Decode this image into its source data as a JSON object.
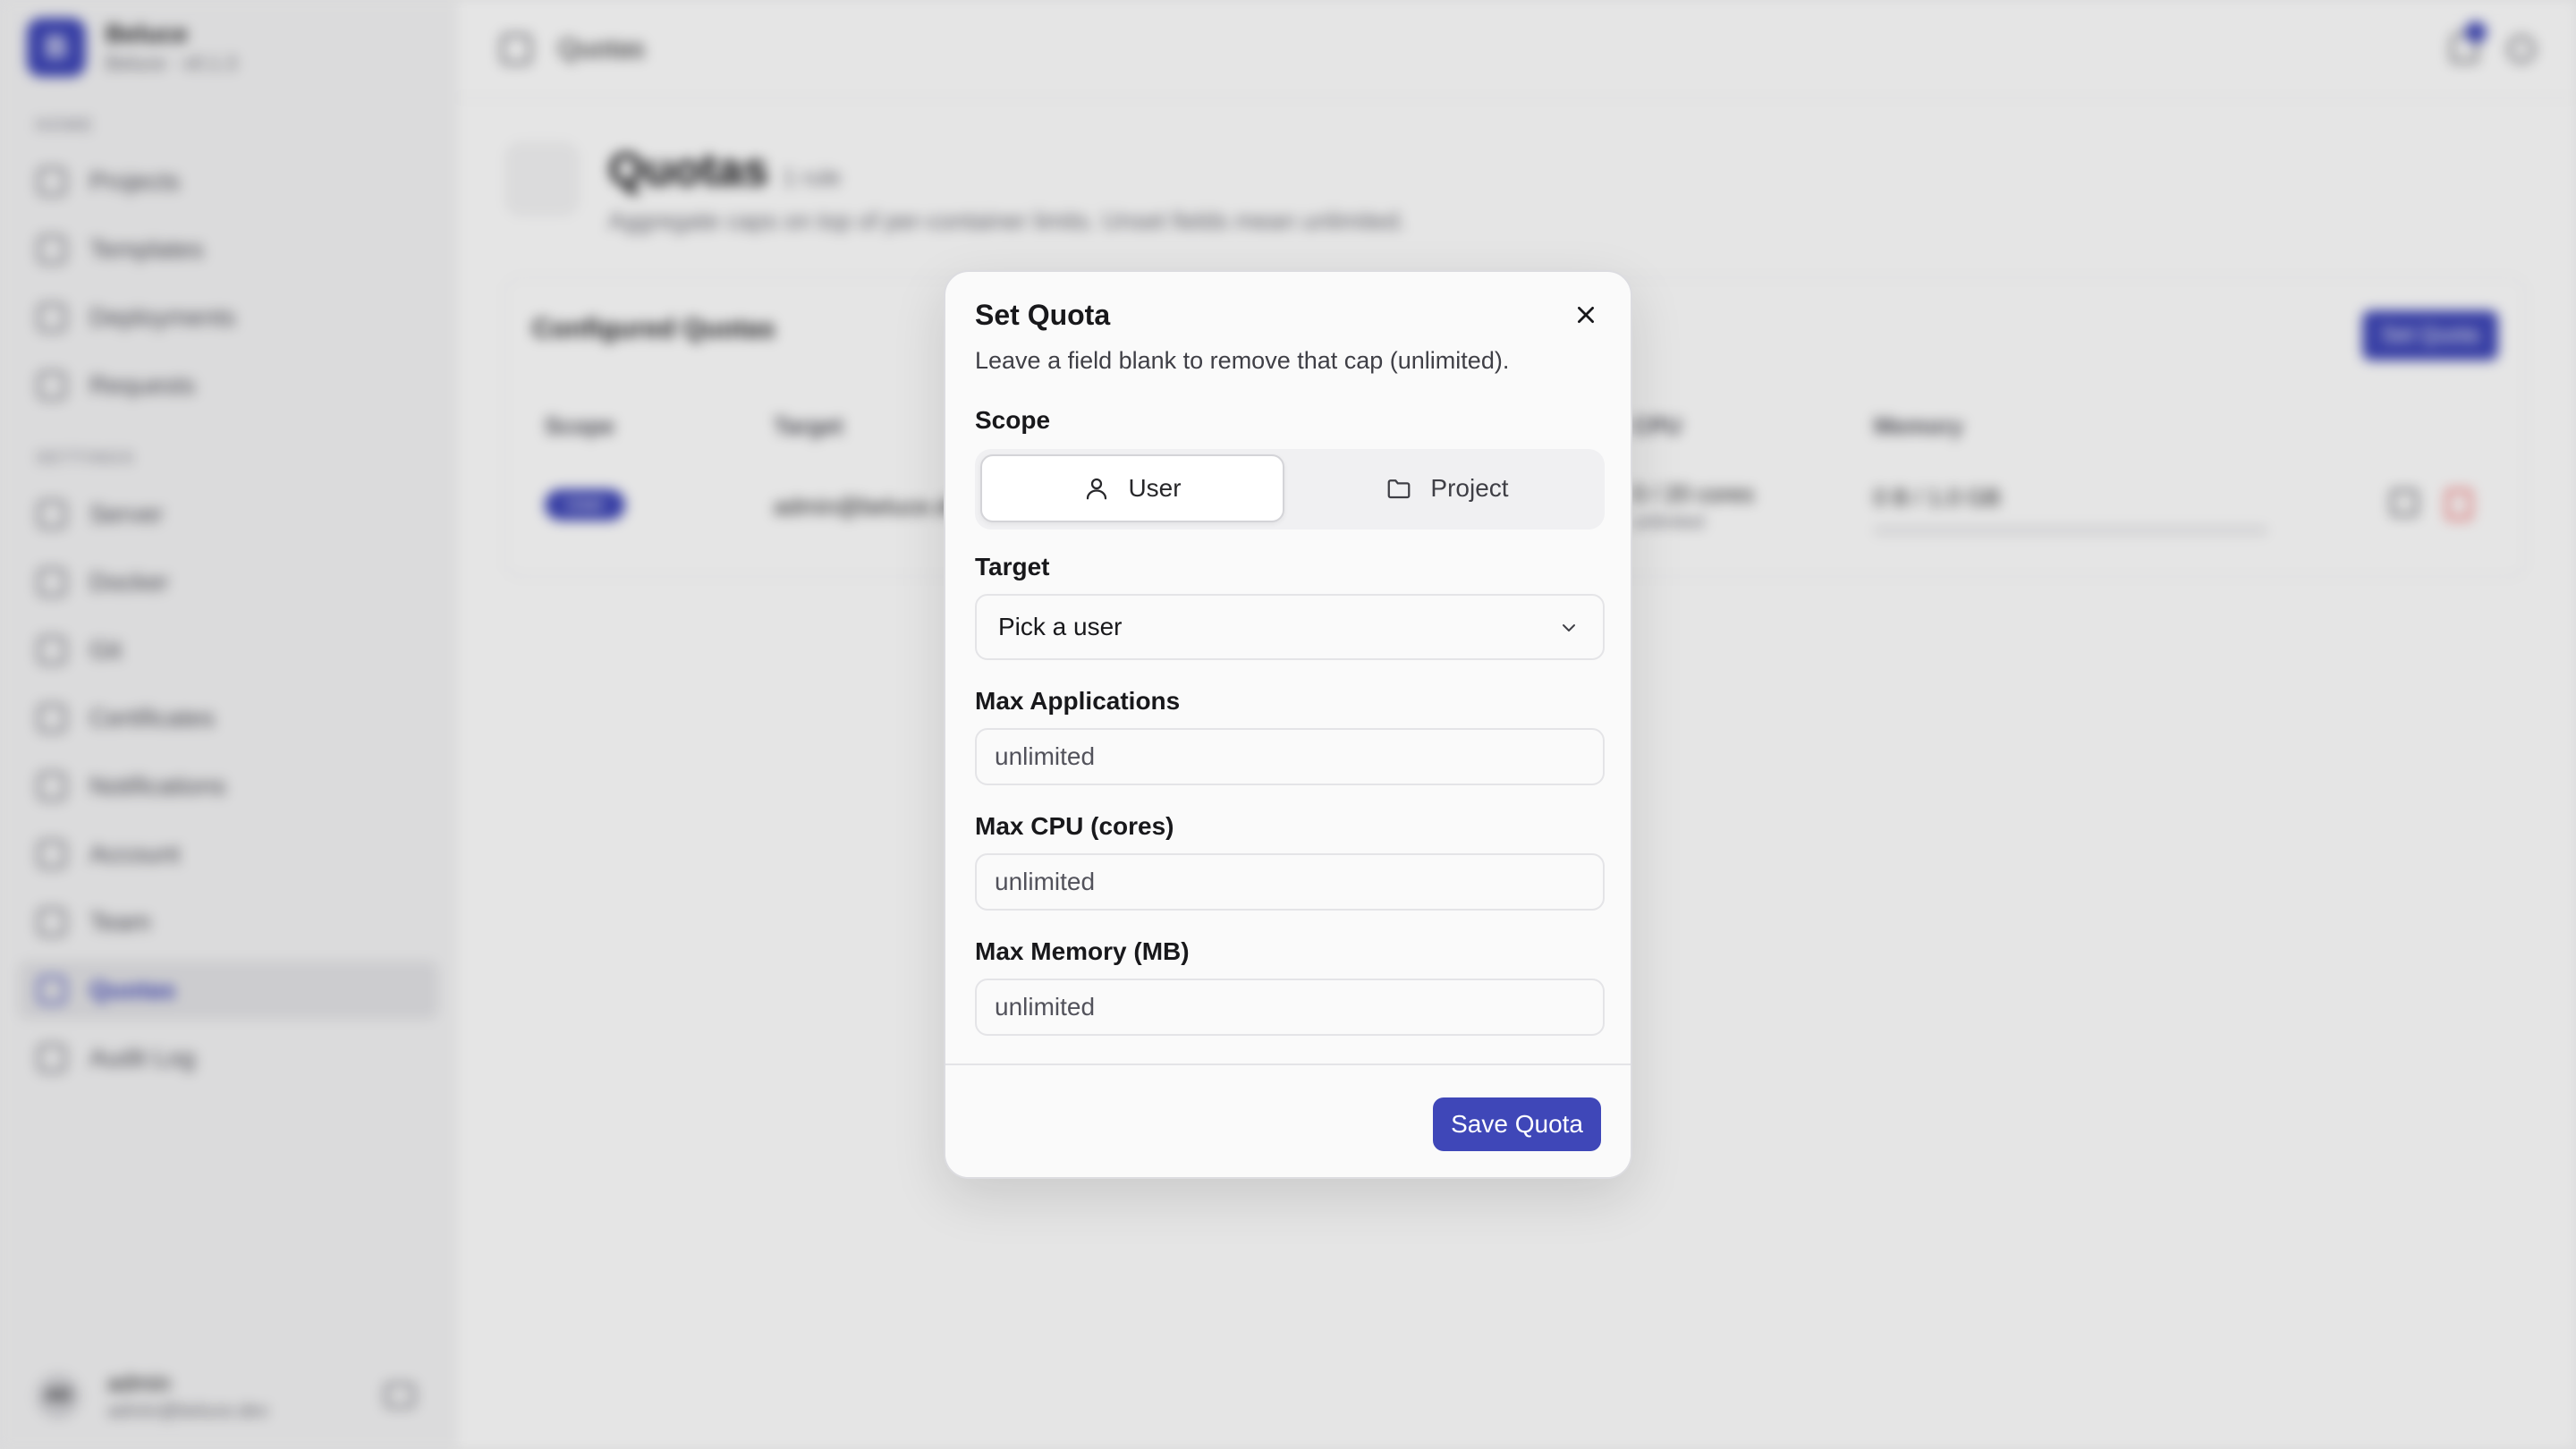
{
  "app": {
    "brand_name": "Beluce",
    "brand_sub": "Beluce · v0.1.3",
    "brand_initial": "B",
    "nav_section_home": "HOME",
    "nav_section_settings": "SETTINGS",
    "nav_home": [
      {
        "label": "Projects",
        "icon": "folder-icon"
      },
      {
        "label": "Templates",
        "icon": "template-icon"
      },
      {
        "label": "Deployments",
        "icon": "rocket-icon"
      },
      {
        "label": "Requests",
        "icon": "request-icon"
      }
    ],
    "nav_settings": [
      {
        "label": "Server",
        "icon": "server-icon"
      },
      {
        "label": "Docker",
        "icon": "docker-icon"
      },
      {
        "label": "Git",
        "icon": "git-icon"
      },
      {
        "label": "Certificates",
        "icon": "certificate-icon"
      },
      {
        "label": "Notifications",
        "icon": "bell-icon"
      },
      {
        "label": "Account",
        "icon": "user-icon"
      },
      {
        "label": "Team",
        "icon": "team-icon"
      },
      {
        "label": "Quotas",
        "icon": "gauge-icon",
        "active": true
      },
      {
        "label": "Audit Log",
        "icon": "log-icon"
      }
    ],
    "user": {
      "initials": "AD",
      "name": "admin",
      "email": "admin@beluce.dev"
    },
    "topbar_title": "Quotas",
    "page": {
      "title": "Quotas",
      "count": "1 rule",
      "description": "Aggregate caps on top of per-container limits. Unset fields mean unlimited."
    },
    "card": {
      "title": "Configured Quotas",
      "button": "Set Quota",
      "columns": [
        "Scope",
        "Target",
        "CPU",
        "Memory"
      ],
      "row": {
        "scope": "User",
        "target": "admin@beluce.dev",
        "cpu": "0 / 20 cores",
        "cpu_sub": "unlimited",
        "memory": "0 B / 1.0 GB"
      }
    }
  },
  "modal": {
    "title": "Set Quota",
    "description": "Leave a field blank to remove that cap (unlimited).",
    "scope_label": "Scope",
    "scope_options": {
      "user": "User",
      "project": "Project"
    },
    "scope_selected": "User",
    "target_label": "Target",
    "target_value": "Pick a user",
    "max_apps_label": "Max Applications",
    "max_apps_placeholder": "unlimited",
    "max_cpu_label": "Max CPU (cores)",
    "max_cpu_placeholder": "unlimited",
    "max_memory_label": "Max Memory (MB)",
    "max_memory_placeholder": "unlimited",
    "save_label": "Save Quota"
  },
  "colors": {
    "accent": "#3f47b8",
    "danger": "#ef4444"
  }
}
